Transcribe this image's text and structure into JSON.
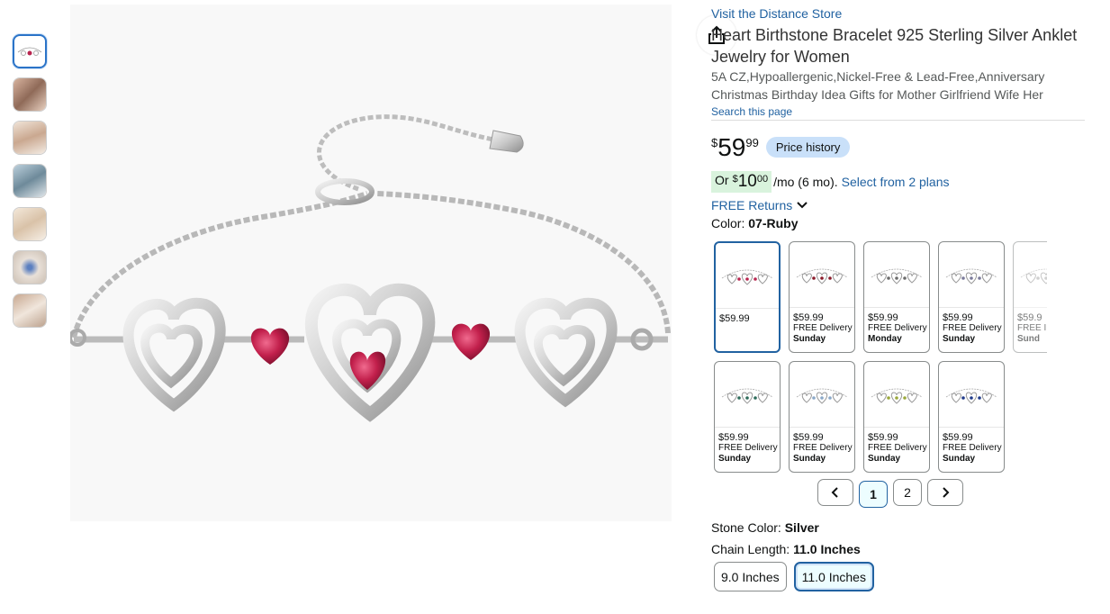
{
  "store_link": "Visit the Distance Store",
  "title": "Heart Birthstone Bracelet 925 Sterling Silver Anklet Jewelry for Women",
  "subtitle": "5A CZ,Hypoallergenic,Nickel-Free & Lead-Free,Anniversary Christmas Birthday Idea Gifts for Mother Girlfriend Wife Her",
  "search_page": "Search this page",
  "price": {
    "currency": "$",
    "whole": "59",
    "fraction": "99",
    "history_label": "Price history"
  },
  "installment": {
    "prefix": "Or",
    "currency": "$",
    "whole": "10",
    "fraction": "00",
    "suffix": "/mo (6 mo).",
    "plans_link": "Select from 2 plans"
  },
  "free_returns": "FREE Returns",
  "color": {
    "label": "Color:",
    "value": "07-Ruby"
  },
  "swatches": [
    {
      "price": "$59.99",
      "delivery": "",
      "day": "",
      "stone": "#b8254f"
    },
    {
      "price": "$59.99",
      "delivery": "FREE Delivery",
      "day": "Sunday",
      "stone": "#8a1a2a"
    },
    {
      "price": "$59.99",
      "delivery": "FREE Delivery",
      "day": "Monday",
      "stone": "#6b6b6b"
    },
    {
      "price": "$59.99",
      "delivery": "FREE Delivery",
      "day": "Sunday",
      "stone": "#7a7a9a"
    },
    {
      "price": "$59.9",
      "delivery": "FREE I",
      "day": "Sund",
      "stone": "#aaaaaa"
    },
    {
      "price": "$59.99",
      "delivery": "FREE Delivery",
      "day": "Sunday",
      "stone": "#2d6b5a"
    },
    {
      "price": "$59.99",
      "delivery": "FREE Delivery",
      "day": "Sunday",
      "stone": "#8aa8c8"
    },
    {
      "price": "$59.99",
      "delivery": "FREE Delivery",
      "day": "Sunday",
      "stone": "#9aa83a"
    },
    {
      "price": "$59.99",
      "delivery": "FREE Delivery",
      "day": "Sunday",
      "stone": "#1f3a8a"
    }
  ],
  "pager": {
    "pages": [
      "1",
      "2"
    ],
    "current": "1"
  },
  "stone_color": {
    "label": "Stone Color:",
    "value": "Silver"
  },
  "chain_length": {
    "label": "Chain Length:",
    "value": "11.0 Inches",
    "options": [
      "9.0 Inches",
      "11.0 Inches"
    ],
    "selected": "11.0 Inches"
  },
  "thumb_colors": [
    "#ffffff",
    "#c99c82",
    "#e7d6c8",
    "#c8d4dc",
    "#ece0d0",
    "#e4ddd6",
    "#e2d2c4"
  ],
  "accent": "#2162a1"
}
